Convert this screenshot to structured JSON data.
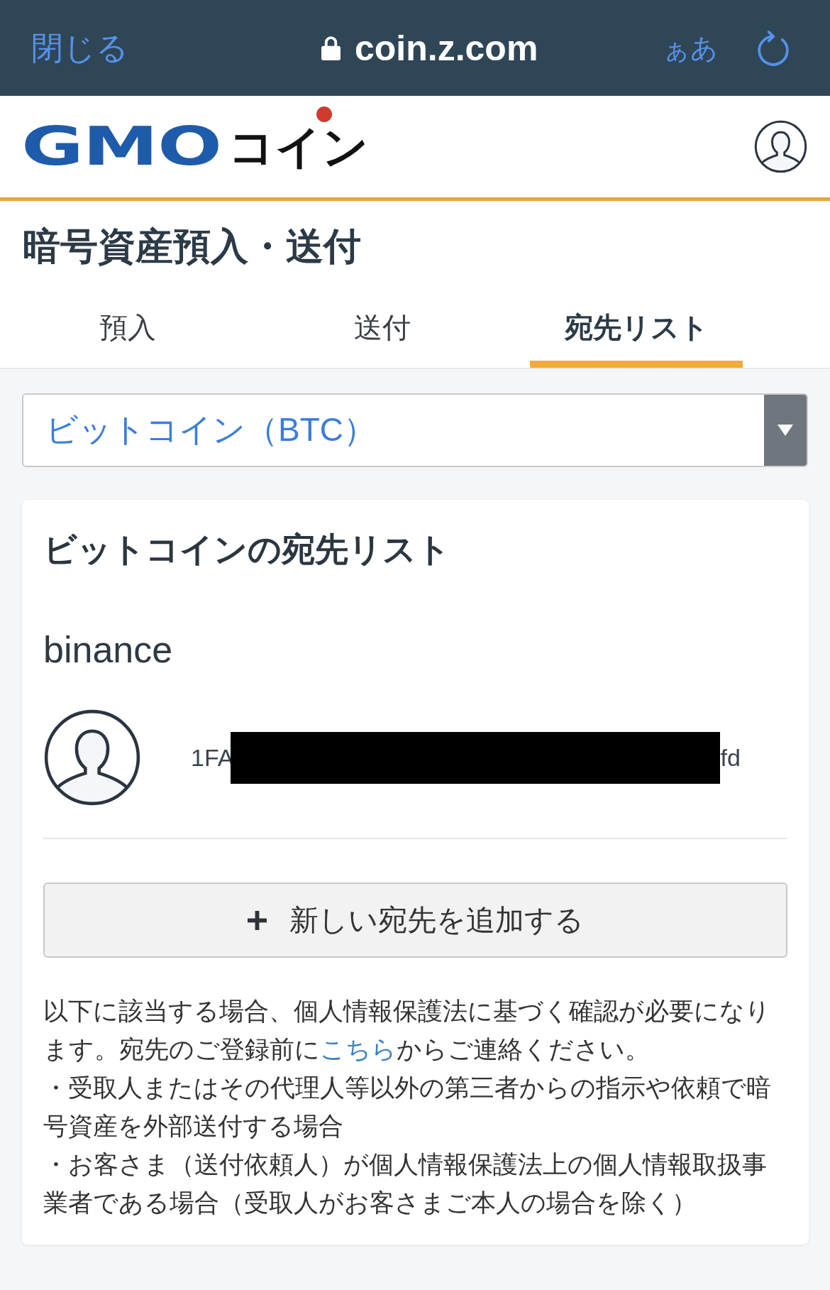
{
  "browser_bar": {
    "close_label": "閉じる",
    "url": "coin.z.com",
    "text_size_label": "ぁあ"
  },
  "header": {
    "logo": {
      "brand": "GMO",
      "product": "コイン"
    }
  },
  "page_title": "暗号資産預入・送付",
  "tabs": [
    {
      "label": "預入",
      "selected": false
    },
    {
      "label": "送付",
      "selected": false
    },
    {
      "label": "宛先リスト",
      "selected": true
    }
  ],
  "currency_select": {
    "value": "ビットコイン（BTC）"
  },
  "address_list": {
    "title": "ビットコインの宛先リスト",
    "entries": [
      {
        "name": "binance",
        "address_start": "1FA",
        "address_end": "fd",
        "redacted": true
      }
    ],
    "add_button": "新しい宛先を追加する"
  },
  "notice": {
    "intro": {
      "before": "以下に該当する場合、個人情報保護法に基づく確認が必要になります。宛先のご登録前に",
      "link": "こちら",
      "after": "からご連絡ください。"
    },
    "conditions": [
      "・受取人またはその代理人等以外の第三者からの指示や依頼で暗号資産を外部送付する場合",
      "・お客さま（送付依頼人）が個人情報保護法上の個人情報取扱事業者である場合（受取人がお客さまご本人の場合を除く）"
    ]
  }
}
